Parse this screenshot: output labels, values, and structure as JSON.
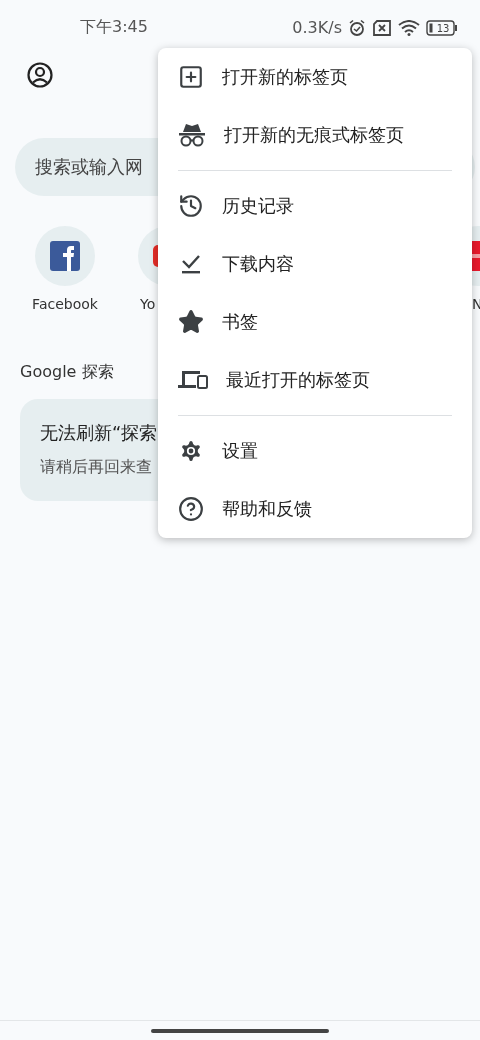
{
  "status_bar": {
    "time": "下午3:45",
    "speed": "0.3K/s",
    "battery": "13"
  },
  "search": {
    "placeholder": "搜索或输入网"
  },
  "shortcuts": [
    {
      "label": "Facebook",
      "kind": "facebook"
    },
    {
      "label": "Yo",
      "kind": "video"
    },
    {
      "label": "N",
      "kind": "red"
    }
  ],
  "discover": {
    "heading": "Google 探索",
    "card_title": "无法刷新“探索",
    "card_text": "请稍后再回来查"
  },
  "menu": {
    "sections": [
      [
        {
          "label": "打开新的标签页",
          "kind": "new-tab"
        },
        {
          "label": "打开新的无痕式标签页",
          "kind": "incognito"
        }
      ],
      [
        {
          "label": "历史记录",
          "kind": "history"
        },
        {
          "label": "下载内容",
          "kind": "download"
        },
        {
          "label": "书签",
          "kind": "star"
        },
        {
          "label": "最近打开的标签页",
          "kind": "devices"
        }
      ],
      [
        {
          "label": "设置",
          "kind": "settings"
        },
        {
          "label": "帮助和反馈",
          "kind": "help"
        }
      ]
    ]
  }
}
